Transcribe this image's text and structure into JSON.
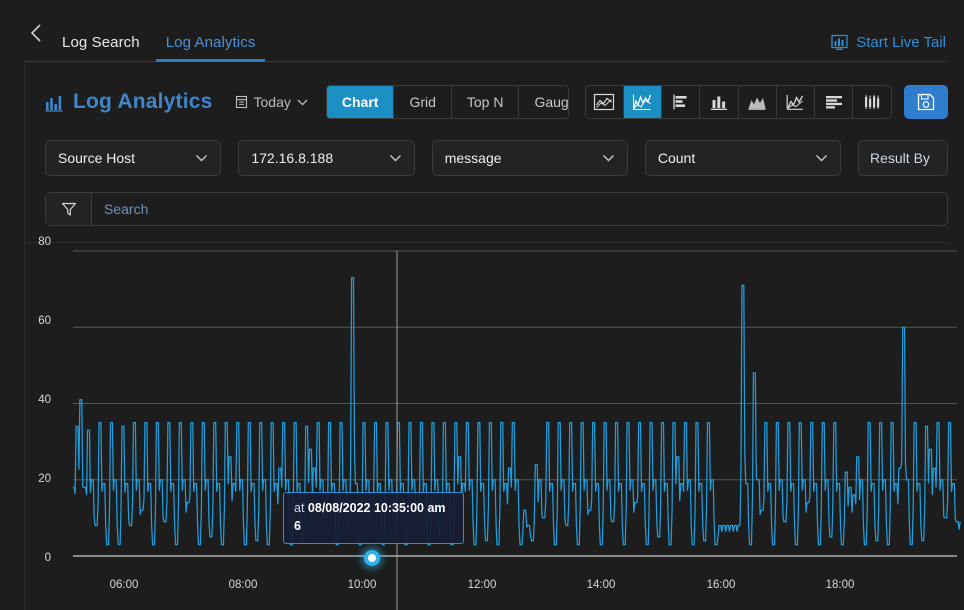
{
  "header": {
    "back_icon": "chevron-left-icon",
    "tabs": [
      {
        "label": "Log Search",
        "active": false
      },
      {
        "label": "Log Analytics",
        "active": true
      }
    ],
    "live_tail": {
      "label": "Start Live Tail",
      "icon": "live-tail-chart-icon",
      "color": "#2f8fd4"
    }
  },
  "toolbar": {
    "brand": {
      "label": "Log Analytics",
      "icon": "bar-chart-icon",
      "color": "#3f86c9"
    },
    "date_range": {
      "label": "Today",
      "icon": "calendar-icon",
      "caret": "chevron-down-icon"
    },
    "view_modes": [
      {
        "label": "Chart",
        "active": true
      },
      {
        "label": "Grid",
        "active": false
      },
      {
        "label": "Top N",
        "active": false
      },
      {
        "label": "Gauge",
        "active": false
      }
    ],
    "chart_types": [
      {
        "name": "area-chart-icon",
        "active": false
      },
      {
        "name": "line-chart-icon",
        "active": true
      },
      {
        "name": "horizontal-bar-chart-icon",
        "active": false
      },
      {
        "name": "column-chart-icon",
        "active": false
      },
      {
        "name": "mountain-area-chart-icon",
        "active": false
      },
      {
        "name": "scatter-line-chart-icon",
        "active": false
      },
      {
        "name": "stacked-bar-chart-icon",
        "active": false
      },
      {
        "name": "candlestick-chart-icon",
        "active": false
      }
    ],
    "save": {
      "name": "save-button",
      "icon": "floppy-disk-icon",
      "color": "#2f7dcd"
    },
    "active_accent": "#1b8ec4"
  },
  "filters": {
    "field_select": {
      "value": "Source Host",
      "caret": "chevron-down-icon"
    },
    "value_select": {
      "value": "172.16.8.188",
      "caret": "chevron-down-icon"
    },
    "column_select": {
      "value": "message",
      "caret": "chevron-down-icon"
    },
    "aggregate_select": {
      "value": "Count",
      "caret": "chevron-down-icon"
    },
    "result_by": {
      "value": "Result By",
      "caret": "chevron-down-icon"
    }
  },
  "search": {
    "filter_icon": "funnel-icon",
    "placeholder": "Search",
    "value": ""
  },
  "tooltip": {
    "prefix": "at",
    "timestamp": "08/08/2022 10:35:00 am",
    "value": "6"
  },
  "chart_data": {
    "type": "line",
    "title": "",
    "xlabel": "",
    "ylabel": "",
    "ylim": [
      0,
      80
    ],
    "yticks": [
      0,
      20,
      40,
      60,
      80
    ],
    "xticks": [
      "06:00",
      "08:00",
      "10:00",
      "12:00",
      "14:00",
      "16:00",
      "18:00"
    ],
    "grid": true,
    "legend_position": "none",
    "series_color": "#1f9ede",
    "series": [
      {
        "name": "Count",
        "values": [
          18,
          34,
          41,
          18,
          33,
          20,
          8,
          35,
          19,
          3,
          35,
          20,
          3,
          34,
          19,
          8,
          35,
          20,
          12,
          35,
          19,
          3,
          35,
          20,
          9,
          35,
          19,
          3,
          35,
          20,
          14,
          35,
          19,
          3,
          35,
          20,
          5,
          35,
          19,
          3,
          35,
          26,
          19,
          35,
          20,
          3,
          35,
          19,
          4,
          35,
          20,
          3,
          35,
          19,
          23,
          35,
          20,
          3,
          35,
          19,
          4,
          34,
          28,
          23,
          35,
          20,
          10,
          35,
          19,
          3,
          35,
          20,
          8,
          73,
          19,
          3,
          35,
          20,
          12,
          35,
          19,
          3,
          35,
          20,
          9,
          35,
          19,
          3,
          35,
          20,
          14,
          35,
          19,
          3,
          35,
          20,
          5,
          35,
          19,
          3,
          35,
          26,
          19,
          35,
          20,
          3,
          35,
          19,
          4,
          35,
          20,
          3,
          35,
          19,
          23,
          35,
          20,
          3,
          12,
          8,
          4,
          24,
          20,
          10,
          35,
          19,
          3,
          35,
          20,
          8,
          35,
          19,
          3,
          35,
          20,
          12,
          35,
          19,
          3,
          35,
          20,
          9,
          35,
          19,
          3,
          35,
          20,
          14,
          35,
          19,
          3,
          35,
          20,
          5,
          35,
          19,
          3,
          35,
          26,
          19,
          35,
          20,
          3,
          35,
          19,
          4,
          35,
          20,
          3,
          8,
          8,
          8,
          8,
          8,
          8,
          71,
          19,
          3,
          48,
          20,
          12,
          35,
          19,
          3,
          35,
          20,
          9,
          35,
          19,
          3,
          35,
          20,
          14,
          35,
          19,
          3,
          35,
          20,
          5,
          35,
          19,
          3,
          22,
          18,
          16,
          26,
          20,
          3,
          35,
          19,
          4,
          35,
          20,
          3,
          35,
          19,
          23,
          60,
          20,
          3,
          35,
          19,
          4,
          34,
          28,
          23,
          35,
          20,
          10,
          35,
          19,
          9
        ]
      }
    ],
    "annotation": {
      "type": "crosshair-tooltip",
      "x": "10:35:00 am",
      "x_date": "08/08/2022",
      "y": 6
    }
  }
}
